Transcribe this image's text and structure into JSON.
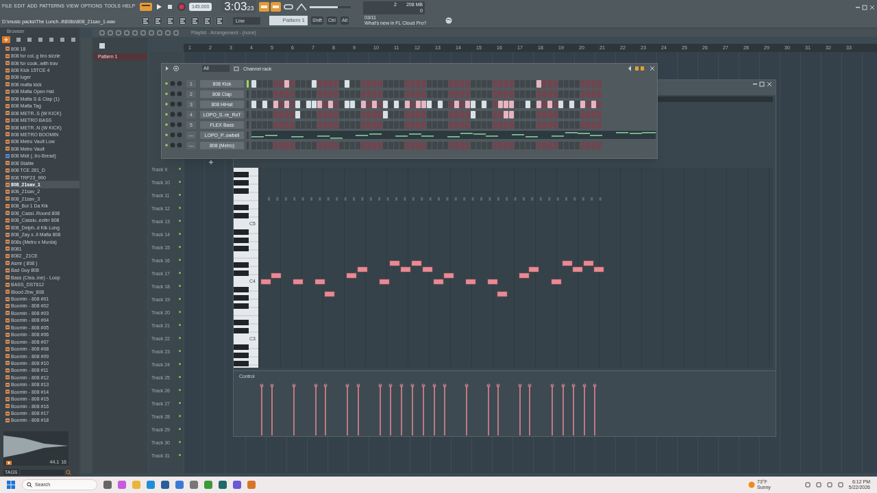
{
  "menu": [
    "FILE",
    "EDIT",
    "ADD",
    "PATTERNS",
    "VIEW",
    "OPTIONS",
    "TOOLS",
    "HELP"
  ],
  "transport": {
    "tempo": "145.000",
    "time": "3:03",
    "time_small": "23"
  },
  "path": "D:\\music packs\\The Lunch..it\\808s\\808_21sav_1.wav",
  "master_volume": {
    "level": 0.67
  },
  "snap": "Line",
  "pattern": "Pattern 1",
  "modifier_keys": [
    "Shift",
    "Ctrl",
    "Alt"
  ],
  "cpu": {
    "polyphony": "2",
    "memory": "208 MB",
    "value": "0"
  },
  "news": {
    "date": "03/11",
    "text": "What's new in FL Cloud Pro?"
  },
  "browser": {
    "title": "Browser",
    "items": [
      {
        "label": "808 18",
        "kind": "audio",
        "selected": false
      },
      {
        "label": "808 for col..g bro sizzle",
        "kind": "audio",
        "selected": false
      },
      {
        "label": "808 for cook..with trav",
        "kind": "audio",
        "selected": false
      },
      {
        "label": "808 Kick 15TCE 4",
        "kind": "audio",
        "selected": false
      },
      {
        "label": "808 luger",
        "kind": "audio",
        "selected": false
      },
      {
        "label": "808 mafia kick",
        "kind": "audio",
        "selected": false
      },
      {
        "label": "808 Mafia Open Hat",
        "kind": "audio",
        "selected": false
      },
      {
        "label": "808 Mafia S & Clap (1)",
        "kind": "audio",
        "selected": false
      },
      {
        "label": "808 Mafia Tag",
        "kind": "audio",
        "selected": false
      },
      {
        "label": "808 METR..S (W KICK)",
        "kind": "audio",
        "selected": false
      },
      {
        "label": "808 METRO BASS",
        "kind": "audio",
        "selected": false
      },
      {
        "label": "808 METR..N (W KICK)",
        "kind": "audio",
        "selected": false
      },
      {
        "label": "808 METRO BOOMIN",
        "kind": "audio",
        "selected": false
      },
      {
        "label": "808 Metro Vault Low",
        "kind": "audio",
        "selected": false
      },
      {
        "label": "808 Metro Vault",
        "kind": "audio",
        "selected": false
      },
      {
        "label": "808 Midi (..tro Bread)",
        "kind": "midi",
        "selected": false
      },
      {
        "label": "808 Stable",
        "kind": "audio",
        "selected": false
      },
      {
        "label": "808 TCE 281_D",
        "kind": "audio",
        "selected": false
      },
      {
        "label": "808 TRP23_990",
        "kind": "audio",
        "selected": false
      },
      {
        "label": "808_21sav_1",
        "kind": "audio",
        "selected": true
      },
      {
        "label": "808_21sav_2",
        "kind": "audio",
        "selected": false
      },
      {
        "label": "808_21sav_3",
        "kind": "audio",
        "selected": false
      },
      {
        "label": "808_Boi 1 Da Kik",
        "kind": "audio",
        "selected": false
      },
      {
        "label": "808_Cassi..Round 808",
        "kind": "audio",
        "selected": false
      },
      {
        "label": "808_Cassiu..eofer 808",
        "kind": "audio",
        "selected": false
      },
      {
        "label": "808_Delph..d Kik Long",
        "kind": "audio",
        "selected": false
      },
      {
        "label": "808_Zay x..ll Mafia 808",
        "kind": "audio",
        "selected": false
      },
      {
        "label": "808s (Metro x Murda)",
        "kind": "audio",
        "selected": false
      },
      {
        "label": "8081",
        "kind": "audio",
        "selected": false
      },
      {
        "label": "8082 _21CE",
        "kind": "audio",
        "selected": false
      },
      {
        "label": "Asmr ( 808 )",
        "kind": "audio",
        "selected": false
      },
      {
        "label": "Bad Guy 808",
        "kind": "audio",
        "selected": false
      },
      {
        "label": "Bass (Clea..ine) - Loop",
        "kind": "audio",
        "selected": false
      },
      {
        "label": "BASS_DST612",
        "kind": "audio",
        "selected": false
      },
      {
        "label": "Blood 2bw_808",
        "kind": "audio",
        "selected": false
      },
      {
        "label": "Boomin - 808 #01",
        "kind": "audio",
        "selected": false
      },
      {
        "label": "Boomin - 808 #02",
        "kind": "audio",
        "selected": false
      },
      {
        "label": "Boomin - 808 #03",
        "kind": "audio",
        "selected": false
      },
      {
        "label": "Boomin - 808 #04",
        "kind": "audio",
        "selected": false
      },
      {
        "label": "Boomin - 808 #05",
        "kind": "audio",
        "selected": false
      },
      {
        "label": "Boomin - 808 #06",
        "kind": "audio",
        "selected": false
      },
      {
        "label": "Boomin - 808 #07",
        "kind": "audio",
        "selected": false
      },
      {
        "label": "Boomin - 808 #08",
        "kind": "audio",
        "selected": false
      },
      {
        "label": "Boomin - 808 #09",
        "kind": "audio",
        "selected": false
      },
      {
        "label": "Boomin - 808 #10",
        "kind": "audio",
        "selected": false
      },
      {
        "label": "Boomin - 808 #11",
        "kind": "audio",
        "selected": false
      },
      {
        "label": "Boomin - 808 #12",
        "kind": "audio",
        "selected": false
      },
      {
        "label": "Boomin - 808 #13",
        "kind": "audio",
        "selected": false
      },
      {
        "label": "Boomin - 808 #14",
        "kind": "audio",
        "selected": false
      },
      {
        "label": "Boomin - 808 #15",
        "kind": "audio",
        "selected": false
      },
      {
        "label": "Boomin - 808 #16",
        "kind": "audio",
        "selected": false
      },
      {
        "label": "Boomin - 808 #17",
        "kind": "audio",
        "selected": false
      },
      {
        "label": "Boomin - 808 #18",
        "kind": "audio",
        "selected": false
      }
    ],
    "sample_rate": "44.1",
    "bits": "16",
    "tags": "TAGS"
  },
  "playlist": {
    "title": "Playlist - Arrangement - (none)",
    "patterns": [
      {
        "label": "Pattern 1",
        "selected": true
      }
    ],
    "ruler": [
      "1",
      "2",
      "3",
      "4",
      "5",
      "6",
      "7",
      "8",
      "9",
      "10",
      "11",
      "12",
      "13",
      "14",
      "15",
      "16",
      "17",
      "18",
      "19",
      "20",
      "21",
      "22",
      "23",
      "24",
      "25",
      "26",
      "27",
      "28",
      "29",
      "30",
      "31",
      "32",
      "33"
    ],
    "tracks": [
      "Track 9",
      "Track 10",
      "Track 11",
      "Track 12",
      "Track 13",
      "Track 14",
      "Track 15",
      "Track 16",
      "Track 17",
      "Track 18",
      "Track 19",
      "Track 20",
      "Track 21",
      "Track 22",
      "Track 23",
      "Track 24",
      "Track 25",
      "Track 26",
      "Track 27",
      "Track 28",
      "Track 29",
      "Track 30",
      "Track 31"
    ]
  },
  "channel_rack": {
    "filter": "All",
    "title": "Channel rack",
    "channels": [
      {
        "number": "1",
        "name": "808 Kick",
        "kind": "steps",
        "selected": true,
        "steps": [
          true,
          false,
          false,
          false,
          false,
          false,
          true,
          false,
          false,
          false,
          false,
          true,
          false,
          false,
          false,
          false,
          false,
          true,
          false,
          false,
          false,
          false,
          false,
          false,
          false,
          false,
          false,
          false,
          false,
          false,
          false,
          false,
          false,
          false,
          false,
          false,
          false,
          false,
          false,
          false,
          false,
          false,
          false,
          false,
          false,
          false,
          false,
          false,
          false,
          false,
          false,
          false,
          true,
          false,
          false,
          false,
          false,
          false,
          false,
          false,
          false,
          false,
          false,
          false
        ]
      },
      {
        "number": "2",
        "name": "808 Clap",
        "kind": "steps",
        "selected": false,
        "steps": [
          false,
          false,
          false,
          false,
          false,
          false,
          false,
          false,
          false,
          false,
          false,
          false,
          false,
          false,
          false,
          false,
          false,
          false,
          false,
          false,
          false,
          false,
          false,
          false,
          false,
          false,
          false,
          false,
          false,
          false,
          false,
          false,
          false,
          false,
          false,
          false,
          false,
          false,
          false,
          false,
          false,
          false,
          false,
          false,
          false,
          false,
          false,
          false,
          false,
          false,
          false,
          false,
          false,
          false,
          false,
          false,
          false,
          false,
          false,
          false,
          false,
          false,
          false,
          false
        ]
      },
      {
        "number": "3",
        "name": "808 HiHat",
        "kind": "steps",
        "selected": false,
        "steps": [
          true,
          false,
          true,
          false,
          true,
          false,
          true,
          false,
          true,
          false,
          true,
          true,
          true,
          false,
          true,
          false,
          false,
          true,
          true,
          false,
          true,
          false,
          true,
          false,
          true,
          false,
          true,
          false,
          true,
          false,
          true,
          true,
          true,
          false,
          true,
          false,
          false,
          true,
          false,
          true,
          true,
          false,
          true,
          false,
          false,
          true,
          true,
          true,
          false,
          false,
          true,
          false,
          true,
          false,
          true,
          false,
          true,
          false,
          true,
          false,
          true,
          false,
          true,
          false
        ]
      },
      {
        "number": "4",
        "name": "LOPO_S..re_RoT",
        "kind": "steps",
        "selected": false,
        "steps": [
          false,
          false,
          false,
          false,
          false,
          false,
          false,
          false,
          true,
          false,
          false,
          false,
          false,
          false,
          false,
          false,
          false,
          false,
          false,
          false,
          false,
          false,
          false,
          false,
          true,
          false,
          false,
          false,
          false,
          false,
          false,
          false,
          false,
          false,
          false,
          false,
          false,
          false,
          false,
          false,
          true,
          false,
          false,
          false,
          false,
          false,
          true,
          true,
          false,
          false,
          false,
          false,
          false,
          false,
          false,
          false,
          false,
          false,
          false,
          false,
          false,
          false,
          false,
          false
        ]
      },
      {
        "number": "5",
        "name": "FLEX Bass",
        "kind": "steps",
        "selected": false,
        "steps": [
          false,
          false,
          false,
          false,
          false,
          false,
          false,
          false,
          false,
          false,
          false,
          false,
          false,
          false,
          false,
          false,
          false,
          false,
          false,
          false,
          false,
          false,
          false,
          false,
          false,
          false,
          false,
          false,
          false,
          false,
          false,
          false,
          false,
          false,
          false,
          false,
          false,
          false,
          false,
          false,
          false,
          false,
          false,
          false,
          false,
          false,
          false,
          false,
          false,
          false,
          false,
          false,
          false,
          false,
          false,
          false,
          false,
          false,
          false,
          false,
          false,
          false,
          false,
          false
        ]
      },
      {
        "number": "—",
        "name": "LOPO_P..owbell",
        "kind": "graph",
        "selected": false
      },
      {
        "number": "—",
        "name": "808 (Metro)",
        "kind": "steps",
        "selected": false,
        "steps": [
          false,
          false,
          false,
          false,
          false,
          false,
          false,
          false,
          false,
          false,
          false,
          false,
          false,
          false,
          false,
          false,
          false,
          false,
          false,
          false,
          false,
          false,
          false,
          false,
          false,
          false,
          false,
          false,
          false,
          false,
          false,
          false,
          false,
          false,
          false,
          false,
          false,
          false,
          false,
          false,
          false,
          false,
          false,
          false,
          false,
          false,
          false,
          false,
          false,
          false,
          false,
          false,
          false,
          false,
          false,
          false,
          false,
          false,
          false,
          false,
          false,
          false,
          false,
          false
        ]
      }
    ]
  },
  "piano_roll": {
    "octaves": [
      "C5",
      "C4",
      "C3"
    ],
    "control": "Control"
  },
  "taskbar": {
    "search": "Search",
    "temp": "73°F",
    "weather": "Sunny",
    "time": "6:12 PM",
    "date": "5/22/2026"
  }
}
